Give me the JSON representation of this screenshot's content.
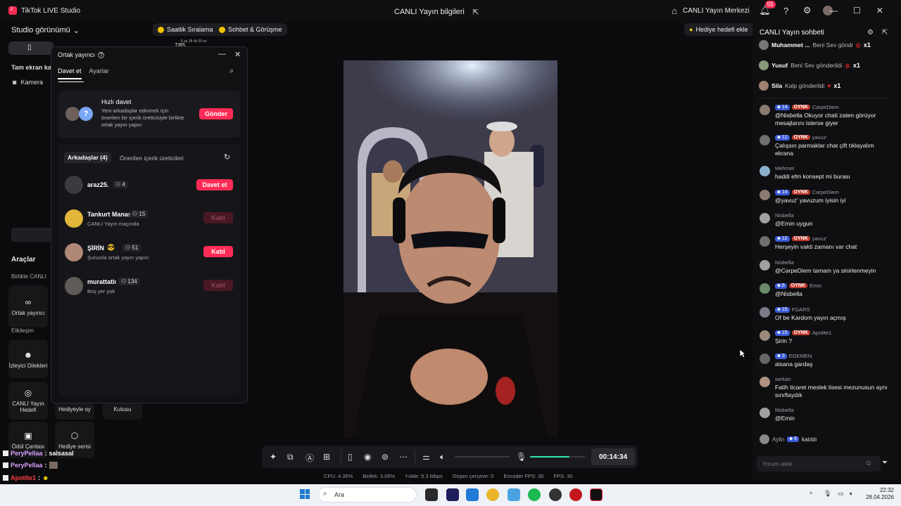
{
  "titlebar": {
    "app_title": "TikTok LIVE Studio",
    "center_title": "CANLI Yayın bilgileri",
    "live_center": "CANLI Yayın Merkezi",
    "notif_count": "55"
  },
  "left": {
    "studio_view": "Studio görünümü",
    "tam_ekran": "Tam ekran ka",
    "camera": "Kamera",
    "araclar": "Araçlar",
    "birlikte": "Birlikte CANLI",
    "ortak_yayinci": "Ortak yayıncı",
    "etkilesim": "Etkileşim",
    "izleyici": "İzleyici Dilekleri",
    "canli_hedefi": "CANLI Yayın Hedefi",
    "hediyeyle_oy": "Hediyeyle oy",
    "kutusu": "Kutusu",
    "odul": "Ödül Çantası",
    "hediye_serisi": "Hediye serisi"
  },
  "topbar": {
    "saatlik": "Saatlik Sıralama",
    "sohbet": "Sohbet & Görüşme",
    "hediye_hedefi": "Hediye hedefi ekle",
    "widget_count": "7/85",
    "widget_time": "5 sa 38 dk 39 sn"
  },
  "popup": {
    "title": "Ortak yayıncı",
    "tab_invite": "Davet et",
    "tab_settings": "Ayarlar",
    "quick_title": "Hızlı davet",
    "quick_desc": "Yeni arkadaşlar edinmek için önerilen bir içerik üreticisiyle birlikte ortak yayın yapın",
    "send": "Gönder",
    "friends_tab": "Arkadaşlar (4)",
    "suggested_tab": "Önerilen içerik üreticileri",
    "friends": [
      {
        "name": "araz25.",
        "count": "4",
        "sub": "",
        "button": "Davet et",
        "enabled": true
      },
      {
        "name": "Tankurt Manas",
        "count": "15",
        "sub": "CANLI Yayın maçında",
        "button": "Katıl",
        "enabled": false
      },
      {
        "name": "ŞİRİN",
        "count": "51",
        "sub": "Şununla ortak yayın yapın:",
        "button": "Katıl",
        "enabled": true
      },
      {
        "name": "murattatlı",
        "count": "134",
        "sub": "Boş yer yok",
        "button": "Katıl",
        "enabled": false
      }
    ]
  },
  "controls": {
    "timer": "00:14:34",
    "volume_level": 0.72
  },
  "stats": {
    "cpu": "CPU: 4.39%",
    "mem": "Bellek: 3.06%",
    "upload": "Yükle: 5.3 Mbps",
    "dropped": "Düşen çerçeve: 0",
    "encoder": "Encoder FPS: 30",
    "fps": "FPS: 30"
  },
  "chat": {
    "title": "CANLI Yayın sohbeti",
    "gifts": [
      {
        "user": "Muhammet ...",
        "text": "Beni Sev göndi",
        "x": "x1"
      },
      {
        "user": "Yusuf",
        "text": "Beni Sev gönderildi",
        "x": "x1"
      },
      {
        "user": "Sila",
        "text": "Kalp gönderildi",
        "x": "x1"
      }
    ],
    "messages": [
      {
        "level": "14",
        "badge": "OYNK",
        "user": "CarpeDiem",
        "text": "@Nisbella Okuyor chati zaten görüyor mesajlarını isterse giyer"
      },
      {
        "level": "12",
        "badge": "OYNK",
        "user": "yavuz'",
        "text": "Çalışsın parmaklar chat çift tıklayalım ekrana"
      },
      {
        "level": "",
        "badge": "",
        "user": "Mehmet",
        "text": "haddi efm konsept mi burası"
      },
      {
        "level": "14",
        "badge": "OYNK",
        "user": "CarpeDiem",
        "text": "@yavuz' yavuzum iyisin iyi"
      },
      {
        "level": "",
        "badge": "",
        "user": "Nisbella",
        "text": "@Emin uygun"
      },
      {
        "level": "12",
        "badge": "OYNK",
        "user": "yavuz'",
        "text": "Herşeyin vakti zamanı var chat"
      },
      {
        "level": "",
        "badge": "",
        "user": "Nisbella",
        "text": "@CarpeDiem tamam ya sinirlenmeyin"
      },
      {
        "level": "6",
        "badge": "OYNK",
        "user": "Emin",
        "text": "@Nisbella"
      },
      {
        "level": "15",
        "badge": "",
        "user": "FGARS",
        "text": "Of be Kardom yayın açmış"
      },
      {
        "level": "15",
        "badge": "OYNK",
        "user": "Apotite1",
        "text": "Şirin ?"
      },
      {
        "level": "3",
        "badge": "",
        "user": "EGEMEN",
        "text": "alsana gardaş"
      },
      {
        "level": "",
        "badge": "",
        "user": "serkan",
        "text": "Fatih ticaret meslek lisesi mezunusun aynı sınıftaydık"
      },
      {
        "level": "",
        "badge": "",
        "user": "Nisbella",
        "text": "@Emin"
      }
    ],
    "joined": {
      "user": "Aylin",
      "level": "6",
      "text": "katıldı"
    },
    "input_placeholder": "Yorum ekle"
  },
  "overlay_users": [
    {
      "name": "PeryPellaa",
      "text": "salsasal",
      "color": "#d9a0ff"
    },
    {
      "name": "PeryPellaa",
      "text": "",
      "color": "#d9a0ff"
    },
    {
      "name": "Apotite1",
      "text": "",
      "color": "#ff3b3b"
    }
  ],
  "taskbar": {
    "search": "Ara",
    "time": "22:32",
    "date": "28.04.2026"
  }
}
